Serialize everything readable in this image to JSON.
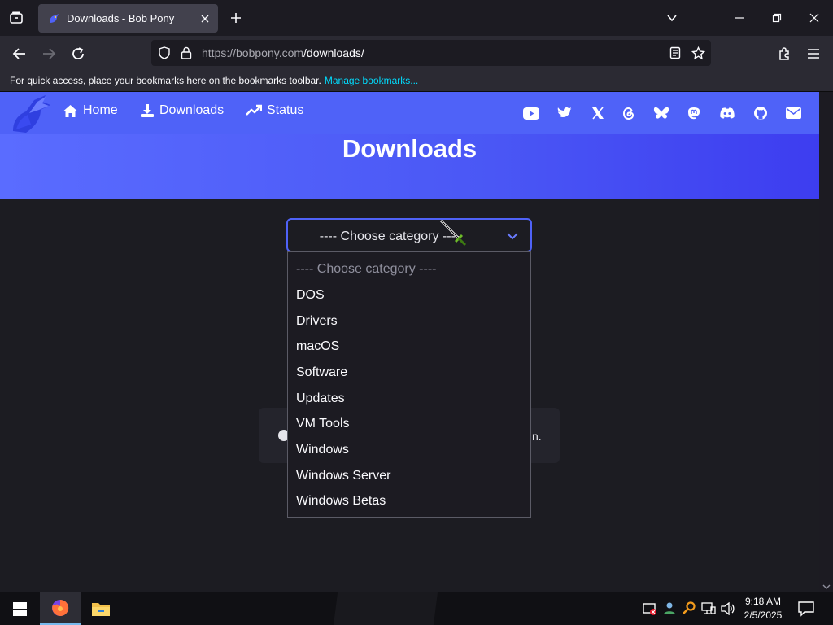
{
  "browser": {
    "tab_title": "Downloads - Bob Pony",
    "url_host": "https://bobpony.com",
    "url_path": "/downloads/",
    "bookmarks_message": "For quick access, place your bookmarks here on the bookmarks toolbar.",
    "bookmarks_link": "Manage bookmarks..."
  },
  "site": {
    "nav": [
      {
        "label": "Home",
        "icon": "home-icon"
      },
      {
        "label": "Downloads",
        "icon": "download-icon"
      },
      {
        "label": "Status",
        "icon": "trend-icon"
      }
    ],
    "social_icons": [
      "youtube-icon",
      "twitter-icon",
      "x-icon",
      "threads-icon",
      "bluesky-icon",
      "mastodon-icon",
      "discord-icon",
      "github-icon",
      "email-icon"
    ],
    "page_title": "Downloads",
    "accent_color": "#4f62f8"
  },
  "category_select": {
    "selected": "---- Choose category ----",
    "options": [
      "---- Choose category ----",
      "DOS",
      "Drivers",
      "macOS",
      "Software",
      "Updates",
      "VM Tools",
      "Windows",
      "Windows Server",
      "Windows Betas"
    ]
  },
  "alert": {
    "visible_tail": "n."
  },
  "taskbar": {
    "time": "9:18 AM",
    "date": "2/5/2025"
  }
}
